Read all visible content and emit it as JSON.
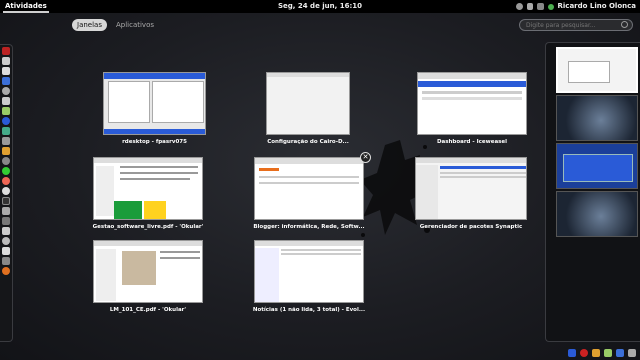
{
  "topbar": {
    "activities_label": "Atividades",
    "clock": "Seg, 24 de jun, 16:10",
    "user_name": "Ricardo Lino Olonca"
  },
  "tabs": [
    {
      "label": "Janelas",
      "active": true
    },
    {
      "label": "Aplicativos",
      "active": false
    }
  ],
  "search": {
    "placeholder": "Digite para pesquisar..."
  },
  "windows": [
    {
      "title": "rdesktop - fpasrv075"
    },
    {
      "title": "Configuração do Cairo-D..."
    },
    {
      "title": "Dashboard - Iceweasel"
    },
    {
      "title": "Gestao_software_livre.pdf - 'Okular'"
    },
    {
      "title": "Blogger: informática, Rede, Softw..."
    },
    {
      "title": "Gerenciador de pacotes Synaptic"
    },
    {
      "title": "LM_101_CE.pdf - 'Okular'"
    },
    {
      "title": "Notícias (1 não lida, 3 total) - Evol..."
    }
  ],
  "close_glyph": "✕",
  "colors": {
    "topbar_bg": "#000000",
    "accent_blue": "#2a5bd7",
    "tab_active_bg": "#d7d7d7"
  },
  "dash_icons": [
    "terminal-icon",
    "file-manager-icon",
    "document-icon",
    "blue-app-icon",
    "chat-icon",
    "mail-icon",
    "pidgin-icon",
    "green-app-icon",
    "blue-app-icon",
    "people-icon",
    "calendar-icon",
    "settings-icon",
    "window-icon",
    "firefox-icon",
    "chrome-icon",
    "terminal-icon",
    "gear-icon",
    "screen-icon",
    "files-icon",
    "clock-icon",
    "mail-icon",
    "app-icon",
    "orange-app-icon"
  ],
  "bottom_tray_icons": [
    "notification-icon",
    "chrome-icon",
    "folder-icon",
    "pidgin-icon",
    "bluetooth-icon",
    "volume-icon"
  ]
}
